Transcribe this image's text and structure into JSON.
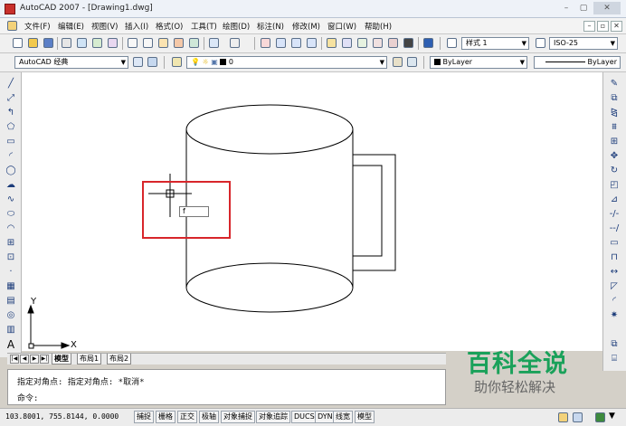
{
  "window": {
    "title": "AutoCAD 2007 - [Drawing1.dwg]",
    "min": "–",
    "max": "▢",
    "close": "✕"
  },
  "menu": {
    "items": [
      "文件(F)",
      "编辑(E)",
      "视图(V)",
      "插入(I)",
      "格式(O)",
      "工具(T)",
      "绘图(D)",
      "标注(N)",
      "修改(M)",
      "窗口(W)",
      "帮助(H)"
    ],
    "doc_controls": [
      "–",
      "▫",
      "✕"
    ]
  },
  "toolbar1": {
    "text_style": "样式 1",
    "dim_style": "ISO-25"
  },
  "toolbar2": {
    "workspace": "AutoCAD 经典",
    "layer": "0",
    "color": "ByLayer",
    "linetype": "ByLayer"
  },
  "ucs": {
    "x_label": "X",
    "y_label": "Y"
  },
  "dynamic_input": {
    "value": "f"
  },
  "tabs": {
    "items": [
      "模型",
      "布局1",
      "布局2"
    ]
  },
  "command": {
    "history": "指定对角点: 指定对角点: *取消*",
    "prompt": "命令:"
  },
  "status": {
    "coordinates": "103.8001, 755.8144, 0.0000",
    "toggles": [
      "捕捉",
      "栅格",
      "正交",
      "极轴",
      "对象捕捉",
      "对象追踪",
      "DUCS",
      "DYN",
      "线宽",
      "模型"
    ]
  },
  "watermark": {
    "title": "百科全说",
    "subtitle": "助你轻松解决"
  },
  "colors": {
    "accent_red": "#d8262b",
    "watermark_green": "#1aa15a"
  }
}
